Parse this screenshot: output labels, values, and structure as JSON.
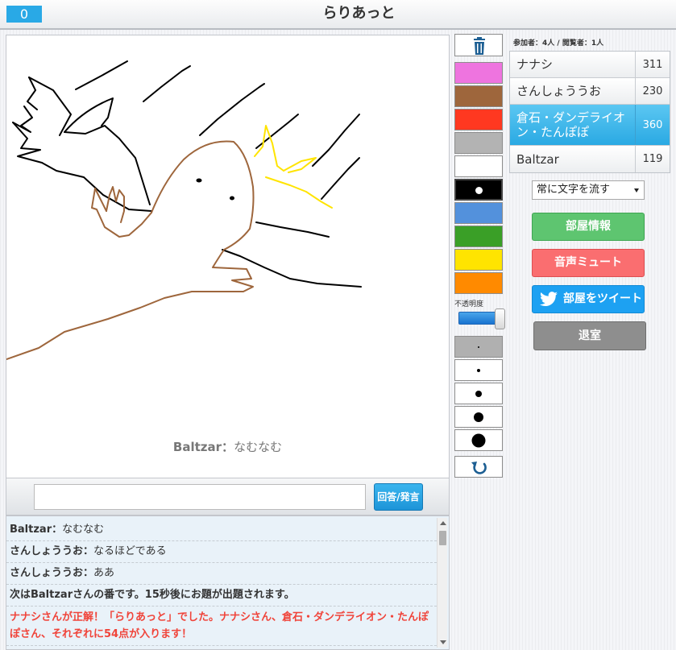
{
  "header": {
    "timer": "0",
    "title": "らりあっと"
  },
  "canvas": {
    "caption_name": "Baltzar",
    "caption_sep": "：",
    "caption_text": "なむなむ"
  },
  "answer": {
    "input_value": "",
    "button_label": "回答/発言"
  },
  "chat": {
    "messages": [
      {
        "name": "Baltzar",
        "sep": "：",
        "text": "なむなむ"
      },
      {
        "name": "さんしょううお",
        "sep": "：",
        "text": "なるほどである"
      },
      {
        "name": "さんしょううお",
        "sep": "：",
        "text": "ああ"
      }
    ],
    "system_message": "次はBaltzarさんの番です。15秒後にお題が出題されます。",
    "correct_message": "ナナシさんが正解！「らりあっと」でした。ナナシさん、倉石・ダンデライオン・たんぽぽさん、それぞれに54点が入ります！"
  },
  "tools": {
    "trash_icon": "trash-icon",
    "colors": [
      {
        "hex": "#ee74df"
      },
      {
        "hex": "#9e663c"
      },
      {
        "hex": "#ff3820"
      },
      {
        "hex": "#b3b3b3"
      },
      {
        "hex": "#ffffff"
      },
      {
        "hex": "#000000",
        "selected": true
      },
      {
        "hex": "#5391dc"
      },
      {
        "hex": "#3a9f27"
      },
      {
        "hex": "#ffe400"
      },
      {
        "hex": "#ff8a00"
      }
    ],
    "opacity_label": "不透明度",
    "opacity_value": 1.0,
    "pen_sizes": [
      {
        "selected": true
      },
      {},
      {},
      {},
      {}
    ],
    "undo_icon": "undo-icon"
  },
  "room": {
    "participants_label": "参加者：",
    "participants_count": "4人",
    "divider": " / ",
    "viewers_label": "閲覧者：",
    "viewers_count": "1人"
  },
  "players": [
    {
      "name": "ナナシ",
      "score": "311"
    },
    {
      "name": "さんしょううお",
      "score": "230"
    },
    {
      "name": "倉石・ダンデライオン・たんぽぽ",
      "score": "360",
      "drawer": true
    },
    {
      "name": "Baltzar",
      "score": "119"
    }
  ],
  "scroll_select": {
    "value": "常に文字を流す"
  },
  "buttons": {
    "room_info": "部屋情報",
    "mute": "音声ミュート",
    "tweet": "部屋をツイート",
    "leave": "退室"
  },
  "colors": {
    "accent": "#29a9e6",
    "green": "#5ec570",
    "red": "#fa6e70",
    "twitter": "#1da1f2",
    "grey": "#8e8e8e",
    "error_text": "#f0443a"
  }
}
